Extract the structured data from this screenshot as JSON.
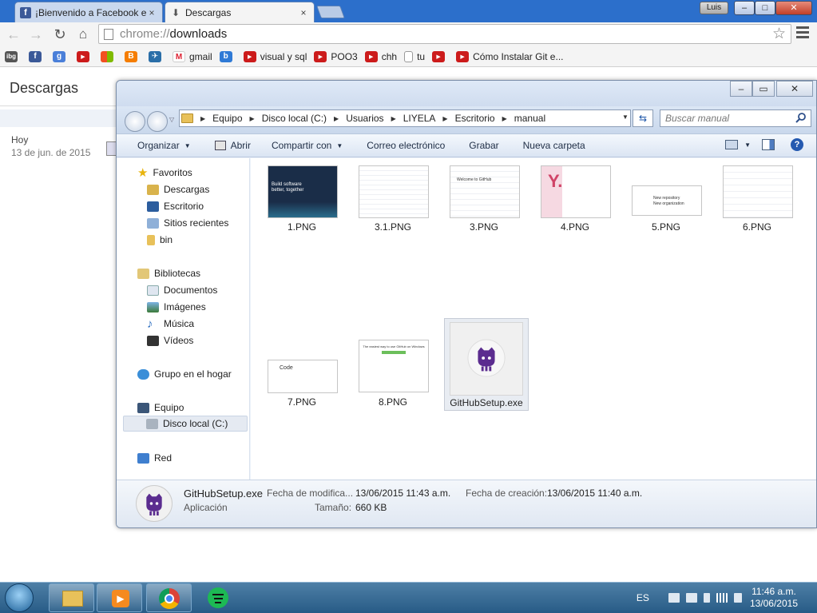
{
  "chrome": {
    "tabs": [
      {
        "title": "¡Bienvenido a Facebook e",
        "close": "×"
      },
      {
        "title": "Descargas",
        "close": "×"
      }
    ],
    "user": "Luis",
    "window_controls": {
      "minimize": "–",
      "maximize": "□",
      "close": "✕"
    },
    "address": {
      "scheme": "chrome://",
      "host": "downloads"
    },
    "bookmarks": [
      {
        "label": "",
        "icon": "fb-icon"
      },
      {
        "label": "",
        "icon": "google-plus-icon"
      },
      {
        "label": "",
        "icon": "youtube-icon"
      },
      {
        "label": "",
        "icon": "windows-icon"
      },
      {
        "label": "",
        "icon": "blogger-icon"
      },
      {
        "label": "",
        "icon": "bird-icon"
      },
      {
        "label": "gmail",
        "icon": "gmail-icon"
      },
      {
        "label": "",
        "icon": "b-icon"
      },
      {
        "label": "visual y sql",
        "icon": "youtube-icon"
      },
      {
        "label": "POO3",
        "icon": "youtube-icon"
      },
      {
        "label": "chh",
        "icon": "youtube-icon"
      },
      {
        "label": "tu",
        "icon": "page-icon"
      },
      {
        "label": "",
        "icon": "youtube-icon"
      },
      {
        "label": "Cómo Instalar Git e...",
        "icon": "youtube-icon"
      }
    ]
  },
  "downloads": {
    "heading": "Descargas",
    "date_label": "Hoy",
    "date": "13 de jun. de 2015"
  },
  "explorer": {
    "breadcrumb": [
      "Equipo",
      "Disco local (C:)",
      "Usuarios",
      "LIYELA",
      "Escritorio",
      "manual"
    ],
    "search_placeholder": "Buscar manual",
    "commands": {
      "organize": "Organizar",
      "open": "Abrir",
      "share": "Compartir con",
      "email": "Correo electrónico",
      "burn": "Grabar",
      "new_folder": "Nueva carpeta"
    },
    "nav": {
      "favorites": "Favoritos",
      "downloads": "Descargas",
      "desktop": "Escritorio",
      "recent": "Sitios recientes",
      "bin": "bin",
      "libraries": "Bibliotecas",
      "documents": "Documentos",
      "images": "Imágenes",
      "music": "Música",
      "videos": "Vídeos",
      "homegroup": "Grupo en el hogar",
      "computer": "Equipo",
      "local_disk": "Disco local (C:)",
      "network": "Red"
    },
    "files": [
      {
        "name": "1.PNG"
      },
      {
        "name": "3.1.PNG"
      },
      {
        "name": "3.PNG"
      },
      {
        "name": "4.PNG"
      },
      {
        "name": "5.PNG"
      },
      {
        "name": "6.PNG"
      },
      {
        "name": "7.PNG"
      },
      {
        "name": "8.PNG"
      },
      {
        "name": "GitHubSetup.exe"
      }
    ],
    "thumb_text": {
      "build": "Build software better, together",
      "welcome": "Welcome to GitHub",
      "code": "Code",
      "easiest": "The easiest way to use GitHub on Windows",
      "new_repo": "New repository",
      "new_org": "New organization"
    },
    "details": {
      "name": "GitHubSetup.exe",
      "type": "Aplicación",
      "modified_label": "Fecha de modifica...",
      "modified": "13/06/2015 11:43 a.m.",
      "created_label": "Fecha de creación:",
      "created": "13/06/2015 11:40 a.m.",
      "size_label": "Tamaño:",
      "size": "660 KB"
    }
  },
  "taskbar": {
    "lang": "ES",
    "time": "11:46 a.m.",
    "date": "13/06/2015"
  }
}
